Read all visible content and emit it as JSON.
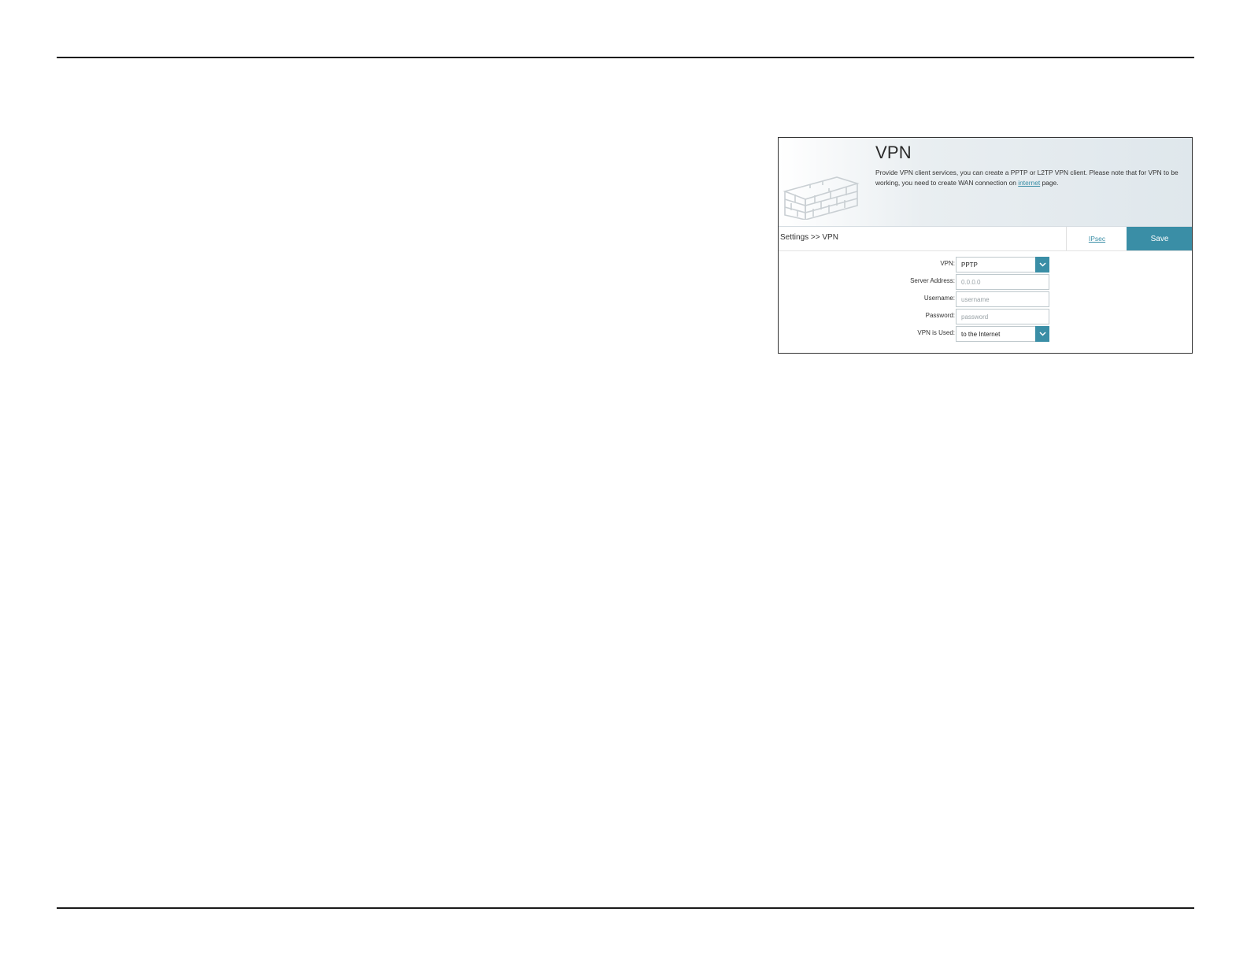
{
  "banner": {
    "title": "VPN",
    "description_prefix": "Provide VPN client services, you can create a PPTP or L2TP VPN client. Please note that for VPN to be working, you need to create WAN connection on ",
    "description_link": "internet",
    "description_suffix": " page."
  },
  "toolbar": {
    "breadcrumb": "Settings >> VPN",
    "ipsec_link": "IPsec",
    "save_label": "Save"
  },
  "form": {
    "vpn": {
      "label": "VPN:",
      "value": "PPTP"
    },
    "server_address": {
      "label": "Server Address:",
      "placeholder": "0.0.0.0"
    },
    "username": {
      "label": "Username:",
      "placeholder": "username"
    },
    "password": {
      "label": "Password:",
      "placeholder": "password"
    },
    "vpn_is_used": {
      "label": "VPN is Used:",
      "value": "to the Internet"
    }
  },
  "icons": {
    "banner_graphic": "brick-wall-icon",
    "dropdown": "chevron-down-icon"
  },
  "colors": {
    "accent": "#3a8ea6",
    "rule": "#1a1a1a"
  }
}
